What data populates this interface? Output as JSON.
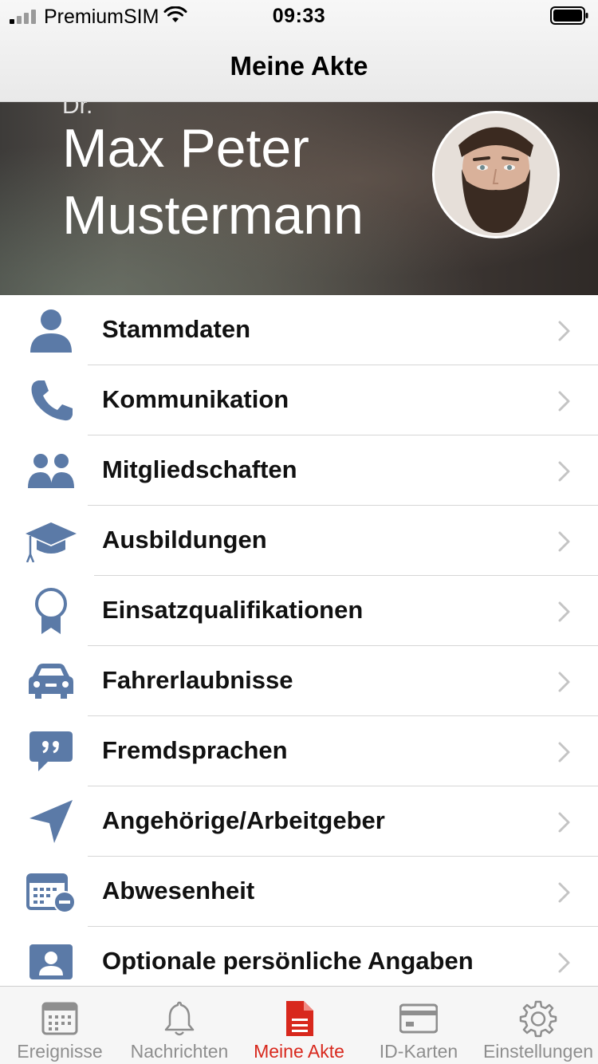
{
  "status_bar": {
    "carrier": "PremiumSIM",
    "time": "09:33"
  },
  "nav": {
    "title": "Meine Akte"
  },
  "profile": {
    "prefix": "Dr.",
    "name": "Max Peter Mustermann"
  },
  "menu": {
    "items": [
      {
        "label": "Stammdaten",
        "icon": "person-icon"
      },
      {
        "label": "Kommunikation",
        "icon": "phone-icon"
      },
      {
        "label": "Mitgliedschaften",
        "icon": "group-icon"
      },
      {
        "label": "Ausbildungen",
        "icon": "graduation-cap-icon"
      },
      {
        "label": "Einsatzqualifikationen",
        "icon": "award-ribbon-icon"
      },
      {
        "label": "Fahrerlaubnisse",
        "icon": "car-icon"
      },
      {
        "label": "Fremdsprachen",
        "icon": "quote-bubble-icon"
      },
      {
        "label": "Angehörige/Arbeitgeber",
        "icon": "location-arrow-icon"
      },
      {
        "label": "Abwesenheit",
        "icon": "calendar-minus-icon"
      },
      {
        "label": "Optionale persönliche Angaben",
        "icon": "contact-card-icon"
      }
    ]
  },
  "tabbar": {
    "tabs": [
      {
        "label": "Ereignisse",
        "icon": "calendar-icon",
        "active": false
      },
      {
        "label": "Nachrichten",
        "icon": "bell-icon",
        "active": false
      },
      {
        "label": "Meine Akte",
        "icon": "document-icon",
        "active": true
      },
      {
        "label": "ID-Karten",
        "icon": "id-card-icon",
        "active": false
      },
      {
        "label": "Einstellungen",
        "icon": "gear-icon",
        "active": false
      }
    ]
  },
  "colors": {
    "icon_blue": "#5b7aa7",
    "active_red": "#d8281d",
    "inactive_gray": "#8e8e8e"
  }
}
